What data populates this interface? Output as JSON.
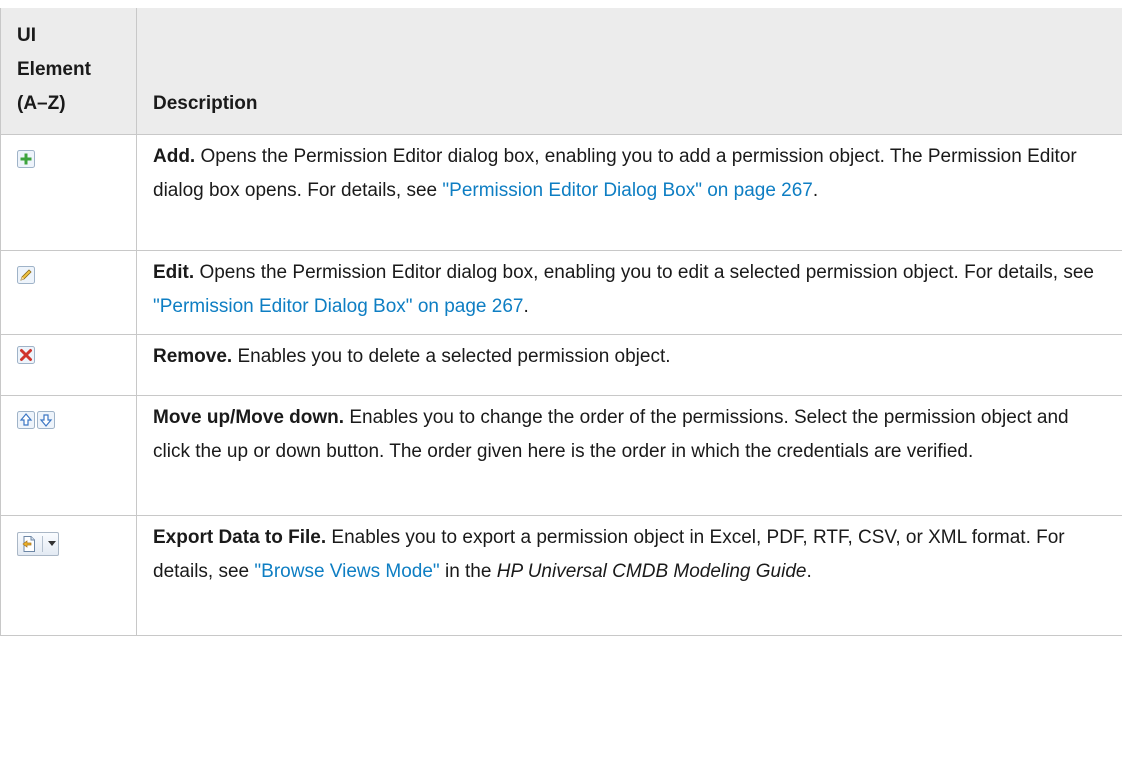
{
  "header": {
    "col1_line1": "UI",
    "col1_line2": "Element",
    "col1_line3": "(A–Z)",
    "col2": "Description"
  },
  "rows": [
    {
      "icon": "add-plus-icon",
      "title": "Add.",
      "text1": " Opens the Permission Editor dialog box, enabling you to add a permission object. The Permission Editor dialog box opens. For details, see ",
      "link": "\"Permission Editor Dialog Box\" on page 267",
      "text2": "."
    },
    {
      "icon": "edit-pencil-icon",
      "title": "Edit.",
      "text1": " Opens the Permission Editor dialog box, enabling you to edit a selected permission object. For details, see ",
      "link": "\"Permission Editor Dialog Box\" on page 267",
      "text2": "."
    },
    {
      "icon": "remove-x-icon",
      "title": "Remove.",
      "text1": " Enables you to delete a selected permission object."
    },
    {
      "icon": "move-up-down-icon",
      "title": "Move up/Move down.",
      "text1": " Enables you to change the order of the permissions. Select the permission object and click the up or down button. The order given here is the order in which the credentials are verified."
    },
    {
      "icon": "export-data-icon",
      "title": "Export Data to File.",
      "text1": " Enables you to export a permission object in Excel, PDF, RTF, CSV, or XML format. For details, see ",
      "link": "\"Browse Views Mode\"",
      "text2": " in the ",
      "italic": "HP Universal CMDB Modeling Guide",
      "text3": "."
    }
  ],
  "colors": {
    "header_bg": "#ececec",
    "border": "#c8c8c8",
    "link": "#0e7ec3"
  }
}
